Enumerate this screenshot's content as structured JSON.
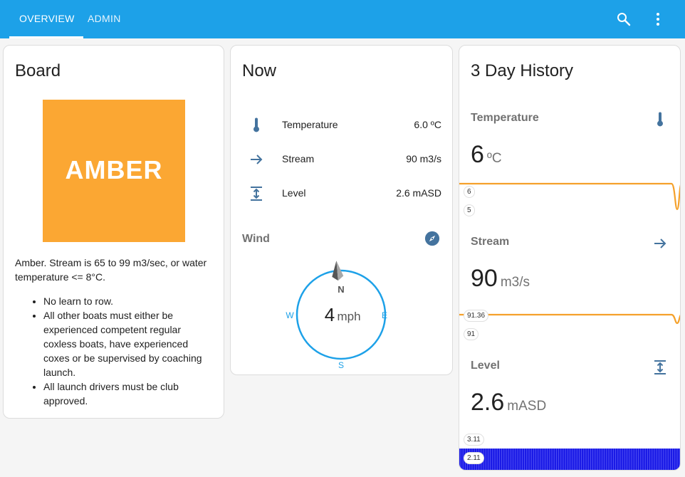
{
  "topbar": {
    "tabs": [
      {
        "label": "OVERVIEW",
        "active": true
      },
      {
        "label": "ADMIN",
        "active": false
      }
    ],
    "color": "#1da1e8",
    "icons": [
      "magnify-icon",
      "dots-vertical-icon"
    ]
  },
  "board": {
    "title": "Board",
    "flag_text": "AMBER",
    "flag_color": "#fba733",
    "description": "Amber. Stream is 65 to 99 m3/sec, or water temperature <= 8°C.",
    "rules": [
      "No learn to row.",
      "All other boats must either be experienced competent regular coxless boats, have experienced coxes or be supervised by coaching launch.",
      "All launch drivers must be club approved."
    ]
  },
  "now": {
    "title": "Now",
    "rows": [
      {
        "icon": "thermometer-icon",
        "label": "Temperature",
        "value": "6.0 ºC"
      },
      {
        "icon": "arrow-right-icon",
        "label": "Stream",
        "value": "90 m3/s"
      },
      {
        "icon": "arrow-expand-vertical-icon",
        "label": "Level",
        "value": "2.6 mASD"
      }
    ],
    "wind": {
      "title": "Wind",
      "speed": "4",
      "unit": "mph",
      "directions": {
        "n": "N",
        "e": "E",
        "s": "S",
        "w": "W"
      },
      "bearing_deg": 355,
      "accent": "#1da1e8"
    }
  },
  "history": {
    "title": "3 Day History",
    "sections": [
      {
        "name": "Temperature",
        "icon": "thermometer-icon",
        "value": "6",
        "unit": "ºC",
        "max_label": "6",
        "min_label": "5",
        "color": "#f5a12b"
      },
      {
        "name": "Stream",
        "icon": "arrow-right-icon",
        "value": "90",
        "unit": "m3/s",
        "max_label": "91.36",
        "min_label": "91",
        "color": "#f5a12b"
      },
      {
        "name": "Level",
        "icon": "arrow-expand-vertical-icon",
        "value": "2.6",
        "unit": "mASD",
        "max_label": "3.11",
        "min_label": "2.11",
        "color": "#1a1ae6"
      }
    ]
  }
}
